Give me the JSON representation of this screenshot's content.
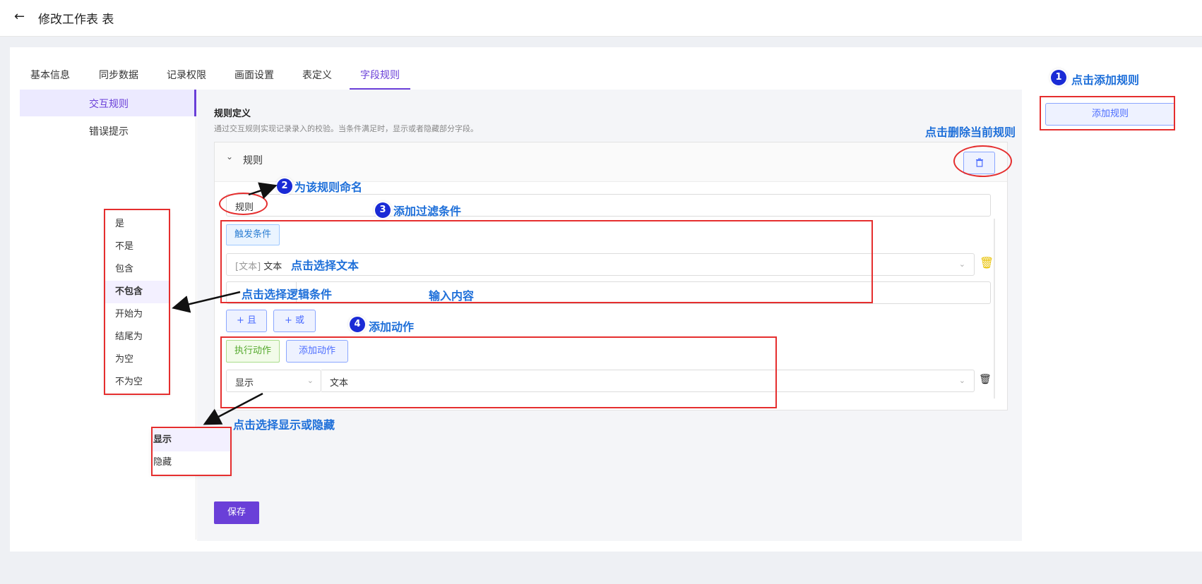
{
  "header": {
    "title": "修改工作表 表"
  },
  "tabs": [
    {
      "label": "基本信息"
    },
    {
      "label": "同步数据"
    },
    {
      "label": "记录权限"
    },
    {
      "label": "画面设置"
    },
    {
      "label": "表定义"
    },
    {
      "label": "字段规则",
      "active": true
    }
  ],
  "subnav": [
    {
      "label": "交互规则",
      "active": true
    },
    {
      "label": "错误提示"
    }
  ],
  "section": {
    "title": "规则定义",
    "description": "通过交互规则实现记录录入的校验。当条件满足时，显示或者隐藏部分字段。"
  },
  "rule": {
    "header_label": "规则",
    "name_value": "规则",
    "trigger_label": "触发条件",
    "field_prefix": "[文本]",
    "field_value": "文本",
    "and_label": "+ 且",
    "or_label": "+ 或",
    "exec_label": "执行动作",
    "add_action_label": "添加动作",
    "display_value": "显示",
    "action_field_value": "文本"
  },
  "buttons": {
    "save": "保存",
    "add_rule": "添加规则"
  },
  "logic_options": [
    "是",
    "不是",
    "包含",
    "不包含",
    "开始为",
    "结尾为",
    "为空",
    "不为空"
  ],
  "logic_selected": "不包含",
  "display_options": [
    "显示",
    "隐藏"
  ],
  "display_selected": "显示",
  "annotations": {
    "step1": "1",
    "step1_text": "点击添加规则",
    "delete_text": "点击删除当前规则",
    "step2": "2",
    "step2_text": "为该规则命名",
    "step3": "3",
    "step3_text": "添加过滤条件",
    "select_text": "点击选择文本",
    "logic_text": "点击选择逻辑条件",
    "input_text": "输入内容",
    "step4": "4",
    "step4_text": "添加动作",
    "display_text": "点击选择显示或隐藏"
  },
  "colors": {
    "accent": "#6a3fd8",
    "annotation_blue": "#1e6fd9",
    "annotation_red": "#e52e2e"
  }
}
